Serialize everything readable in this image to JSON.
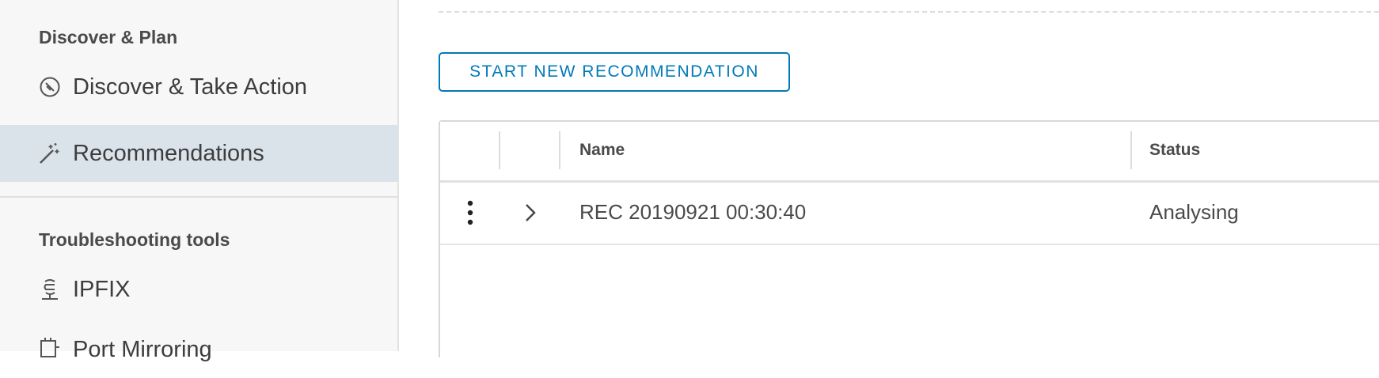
{
  "sidebar": {
    "sections": [
      {
        "title": "Discover & Plan",
        "items": [
          {
            "label": "Discover & Take Action",
            "icon": "compass-icon",
            "active": false
          },
          {
            "label": "Recommendations",
            "icon": "magic-wand-icon",
            "active": true
          }
        ]
      },
      {
        "title": "Troubleshooting tools",
        "items": [
          {
            "label": "IPFIX",
            "icon": "ipfix-icon",
            "active": false
          },
          {
            "label": "Port Mirroring",
            "icon": "port-mirroring-icon",
            "active": false
          }
        ]
      }
    ]
  },
  "main": {
    "start_button_label": "START NEW RECOMMENDATION",
    "grid": {
      "columns": [
        "Name",
        "Status"
      ],
      "rows": [
        {
          "name": "REC 20190921 00:30:40",
          "status": "Analysing"
        }
      ]
    }
  },
  "colors": {
    "accent": "#0079b8",
    "active_nav_bg": "#dae2ea",
    "sidebar_bg": "#f7f7f7"
  }
}
